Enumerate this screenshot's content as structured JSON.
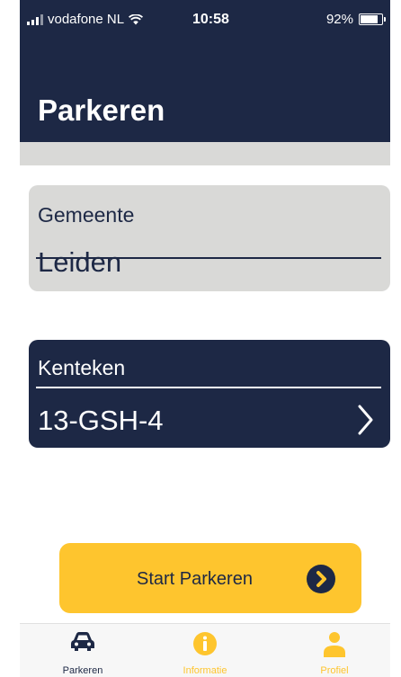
{
  "status_bar": {
    "carrier": "vodafone NL",
    "time": "10:58",
    "battery": "92%",
    "battery_level": 0.92
  },
  "header": {
    "title": "Parkeren"
  },
  "gemeente": {
    "label": "Gemeente",
    "value": "Leiden"
  },
  "kenteken": {
    "label": "Kenteken",
    "value": "13-GSH-4"
  },
  "start_button": {
    "label": "Start Parkeren"
  },
  "tabs": [
    {
      "label": "Parkeren",
      "icon": "car-icon",
      "active": true
    },
    {
      "label": "Informatie",
      "icon": "info-icon",
      "active": false
    },
    {
      "label": "Profiel",
      "icon": "person-icon",
      "active": false
    }
  ],
  "colors": {
    "navy": "#1d2845",
    "yellow": "#fec52e",
    "gray": "#d9d9d7"
  }
}
